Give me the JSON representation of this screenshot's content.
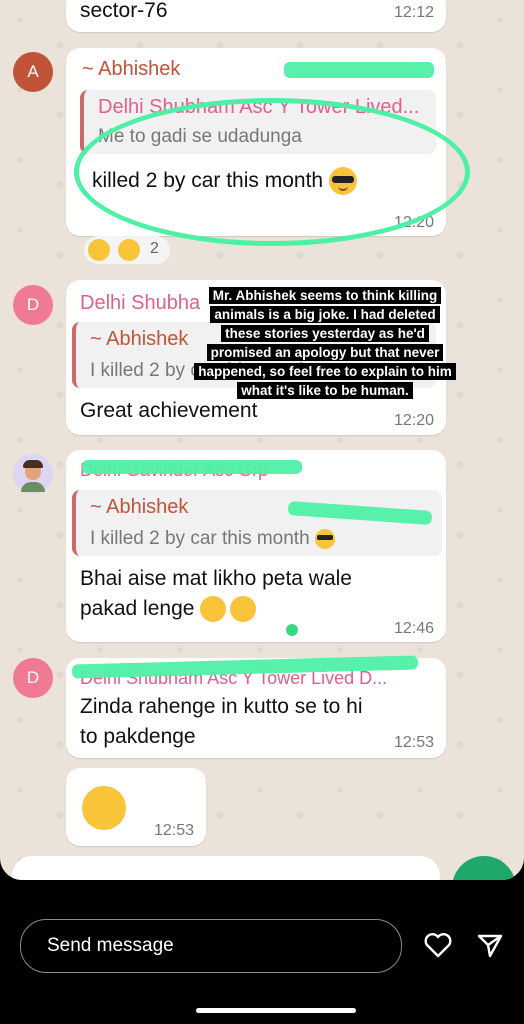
{
  "messages": {
    "m0": {
      "text": "sector-76",
      "time": "12:12"
    },
    "m1": {
      "avatar": "A",
      "sender": "~ Abhishek",
      "quote_name": "Delhi Shubham Asc Y Tower Lived...",
      "quote_text": "Me to gadi se udadunga",
      "text": "killed 2 by car this month",
      "time": "12:20",
      "reaction_count": "2"
    },
    "m2": {
      "avatar": "D",
      "sender": "Delhi Shubham Asc Y Tower Lived D...",
      "quote_name": "~ Abhishek",
      "quote_text": "I killed 2 by car this month",
      "text": "Great achievement",
      "time": "12:20"
    },
    "m3": {
      "sender": "Delhi Gavinder Asc Grp",
      "quote_name": "~ Abhishek",
      "quote_text": "I killed 2 by car this month",
      "text": "Bhai aise mat likho peta wale pakad lenge",
      "time": "12:46"
    },
    "m4": {
      "avatar": "D",
      "sender": "Delhi Shubham Asc Y Tower Lived D...",
      "text": "Zinda rahenge in kutto se to hi to pakdenge",
      "time": "12:53"
    },
    "m5": {
      "time": "12:53"
    }
  },
  "caption": "Mr. Abhishek seems to think killing animals is a big joke. I had deleted these stories yesterday as he'd promised an apology but that never happened, so feel free to explain to him what it's like to be human.",
  "reply": {
    "placeholder": "Send message"
  },
  "colors": {
    "highlight": "#4ef0a6",
    "avatar_a": "#c0533a",
    "avatar_d": "#f07a93",
    "sender_abhishek": "#c0533a",
    "sender_delhi": "#e0608a"
  }
}
